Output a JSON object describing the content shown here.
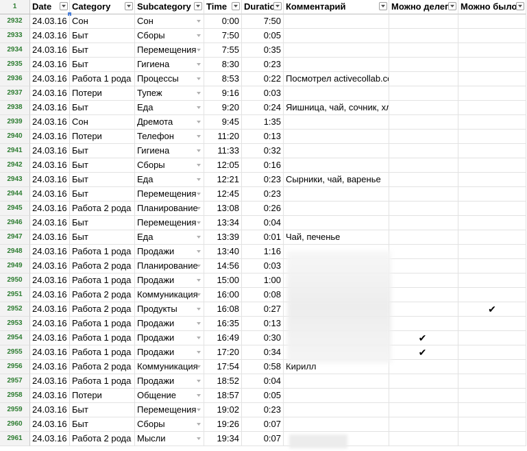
{
  "header": {
    "corner": "1",
    "columns": [
      "Date",
      "Category",
      "Subcategory",
      "Time",
      "Duratio",
      "Комментарий",
      "Можно делег",
      "Можно было"
    ]
  },
  "rows": [
    {
      "num": "2932",
      "date": "24.03.16",
      "cat": "Сон",
      "sub": "Сон",
      "time": "0:00",
      "dur": "7:50",
      "com": "",
      "del": "",
      "bylo": ""
    },
    {
      "num": "2933",
      "date": "24.03.16",
      "cat": "Быт",
      "sub": "Сборы",
      "time": "7:50",
      "dur": "0:05",
      "com": "",
      "del": "",
      "bylo": ""
    },
    {
      "num": "2934",
      "date": "24.03.16",
      "cat": "Быт",
      "sub": "Перемещения",
      "time": "7:55",
      "dur": "0:35",
      "com": "",
      "del": "",
      "bylo": ""
    },
    {
      "num": "2935",
      "date": "24.03.16",
      "cat": "Быт",
      "sub": "Гигиена",
      "time": "8:30",
      "dur": "0:23",
      "com": "",
      "del": "",
      "bylo": ""
    },
    {
      "num": "2936",
      "date": "24.03.16",
      "cat": "Работа 1 рода",
      "sub": "Процессы",
      "time": "8:53",
      "dur": "0:22",
      "com": "Посмотрел activecollab.com",
      "del": "",
      "bylo": ""
    },
    {
      "num": "2937",
      "date": "24.03.16",
      "cat": "Потери",
      "sub": "Тупеж",
      "time": "9:16",
      "dur": "0:03",
      "com": "",
      "del": "",
      "bylo": ""
    },
    {
      "num": "2938",
      "date": "24.03.16",
      "cat": "Быт",
      "sub": "Еда",
      "time": "9:20",
      "dur": "0:24",
      "com": "Яишница, чай, сочник, хлеб",
      "del": "",
      "bylo": ""
    },
    {
      "num": "2939",
      "date": "24.03.16",
      "cat": "Сон",
      "sub": "Дремота",
      "time": "9:45",
      "dur": "1:35",
      "com": "",
      "del": "",
      "bylo": ""
    },
    {
      "num": "2940",
      "date": "24.03.16",
      "cat": "Потери",
      "sub": "Телефон",
      "time": "11:20",
      "dur": "0:13",
      "com": "",
      "del": "",
      "bylo": ""
    },
    {
      "num": "2941",
      "date": "24.03.16",
      "cat": "Быт",
      "sub": "Гигиена",
      "time": "11:33",
      "dur": "0:32",
      "com": "",
      "del": "",
      "bylo": ""
    },
    {
      "num": "2942",
      "date": "24.03.16",
      "cat": "Быт",
      "sub": "Сборы",
      "time": "12:05",
      "dur": "0:16",
      "com": "",
      "del": "",
      "bylo": ""
    },
    {
      "num": "2943",
      "date": "24.03.16",
      "cat": "Быт",
      "sub": "Еда",
      "time": "12:21",
      "dur": "0:23",
      "com": "Сырники, чай, варенье",
      "del": "",
      "bylo": ""
    },
    {
      "num": "2944",
      "date": "24.03.16",
      "cat": "Быт",
      "sub": "Перемещения",
      "time": "12:45",
      "dur": "0:23",
      "com": "",
      "del": "",
      "bylo": ""
    },
    {
      "num": "2945",
      "date": "24.03.16",
      "cat": "Работа 2 рода",
      "sub": "Планирование",
      "time": "13:08",
      "dur": "0:26",
      "com": "",
      "del": "",
      "bylo": ""
    },
    {
      "num": "2946",
      "date": "24.03.16",
      "cat": "Быт",
      "sub": "Перемещения",
      "time": "13:34",
      "dur": "0:04",
      "com": "",
      "del": "",
      "bylo": ""
    },
    {
      "num": "2947",
      "date": "24.03.16",
      "cat": "Быт",
      "sub": "Еда",
      "time": "13:39",
      "dur": "0:01",
      "com": "Чай, печенье",
      "del": "",
      "bylo": ""
    },
    {
      "num": "2948",
      "date": "24.03.16",
      "cat": "Работа 1 рода",
      "sub": "Продажи",
      "time": "13:40",
      "dur": "1:16",
      "com": "",
      "del": "",
      "bylo": ""
    },
    {
      "num": "2949",
      "date": "24.03.16",
      "cat": "Работа 2 рода",
      "sub": "Планирование",
      "time": "14:56",
      "dur": "0:03",
      "com": "",
      "del": "",
      "bylo": ""
    },
    {
      "num": "2950",
      "date": "24.03.16",
      "cat": "Работа 1 рода",
      "sub": "Продажи",
      "time": "15:00",
      "dur": "1:00",
      "com": "",
      "del": "",
      "bylo": ""
    },
    {
      "num": "2951",
      "date": "24.03.16",
      "cat": "Работа 2 рода",
      "sub": "Коммуникация",
      "time": "16:00",
      "dur": "0:08",
      "com": "",
      "del": "",
      "bylo": ""
    },
    {
      "num": "2952",
      "date": "24.03.16",
      "cat": "Работа 2 рода",
      "sub": "Продукты",
      "time": "16:08",
      "dur": "0:27",
      "com": "",
      "del": "",
      "bylo": "✔"
    },
    {
      "num": "2953",
      "date": "24.03.16",
      "cat": "Работа 1 рода",
      "sub": "Продажи",
      "time": "16:35",
      "dur": "0:13",
      "com": "",
      "del": "",
      "bylo": ""
    },
    {
      "num": "2954",
      "date": "24.03.16",
      "cat": "Работа 1 рода",
      "sub": "Продажи",
      "time": "16:49",
      "dur": "0:30",
      "com": "",
      "del": "✔",
      "bylo": ""
    },
    {
      "num": "2955",
      "date": "24.03.16",
      "cat": "Работа 1 рода",
      "sub": "Продажи",
      "time": "17:20",
      "dur": "0:34",
      "com": "",
      "del": "✔",
      "bylo": ""
    },
    {
      "num": "2956",
      "date": "24.03.16",
      "cat": "Работа 2 рода",
      "sub": "Коммуникация",
      "time": "17:54",
      "dur": "0:58",
      "com": "Кирилл",
      "del": "",
      "bylo": ""
    },
    {
      "num": "2957",
      "date": "24.03.16",
      "cat": "Работа 1 рода",
      "sub": "Продажи",
      "time": "18:52",
      "dur": "0:04",
      "com": "",
      "del": "",
      "bylo": ""
    },
    {
      "num": "2958",
      "date": "24.03.16",
      "cat": "Потери",
      "sub": "Общение",
      "time": "18:57",
      "dur": "0:05",
      "com": "",
      "del": "",
      "bylo": ""
    },
    {
      "num": "2959",
      "date": "24.03.16",
      "cat": "Быт",
      "sub": "Перемещения",
      "time": "19:02",
      "dur": "0:23",
      "com": "",
      "del": "",
      "bylo": ""
    },
    {
      "num": "2960",
      "date": "24.03.16",
      "cat": "Быт",
      "sub": "Сборы",
      "time": "19:26",
      "dur": "0:07",
      "com": "",
      "del": "",
      "bylo": ""
    },
    {
      "num": "2961",
      "date": "24.03.16",
      "cat": "Работа 2 рода",
      "sub": "Мысли",
      "time": "19:34",
      "dur": "0:07",
      "com": "",
      "del": "",
      "bylo": ""
    }
  ]
}
